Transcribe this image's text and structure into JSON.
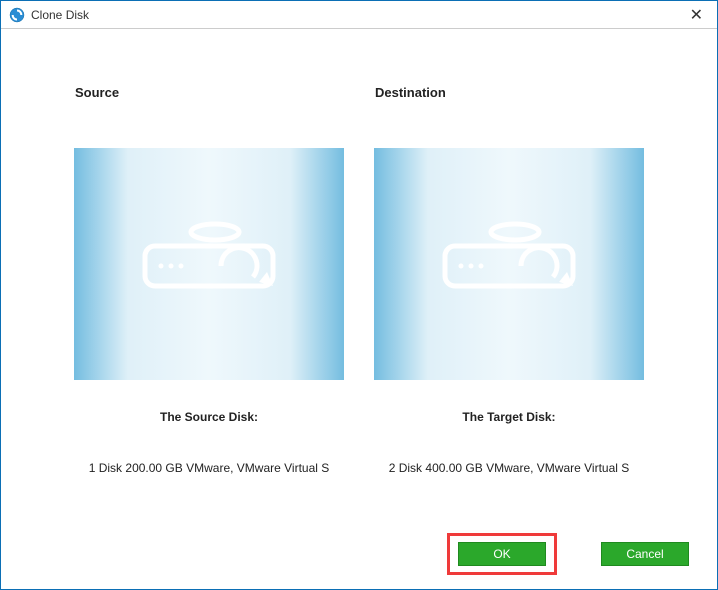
{
  "window": {
    "title": "Clone Disk"
  },
  "panels": {
    "source": {
      "header": "Source",
      "section_label": "The Source Disk:",
      "desc": "1 Disk 200.00 GB VMware,  VMware Virtual S"
    },
    "destination": {
      "header": "Destination",
      "section_label": "The Target Disk:",
      "desc": "2 Disk 400.00 GB VMware,  VMware Virtual S"
    }
  },
  "buttons": {
    "ok": "OK",
    "cancel": "Cancel"
  }
}
